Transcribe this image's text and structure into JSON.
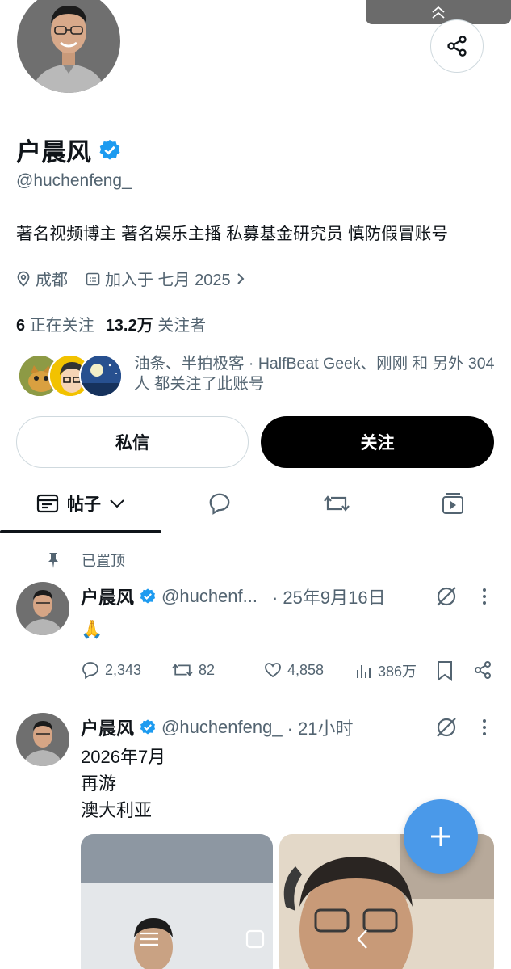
{
  "profile": {
    "name": "户晨风",
    "handle": "@huchenfeng_",
    "bio": "著名视频博主 著名娱乐主播 私募基金研究员 慎防假冒账号",
    "location": "成都",
    "joined": "加入于 七月 2025",
    "following_count": "6",
    "following_label": "正在关注",
    "followers_count": "13.2万",
    "followers_label": "关注者",
    "mutuals_text": "油条、半拍极客 · HalfBeat Geek、刚刚 和 另外 304 人 都关注了此账号"
  },
  "buttons": {
    "dm": "私信",
    "follow": "关注"
  },
  "tabs": {
    "posts": "帖子"
  },
  "pinned_label": "已置顶",
  "posts": [
    {
      "name": "户晨风",
      "handle": "@huchenf...",
      "time": "· 25年9月16日",
      "text": "🙏",
      "replies": "2,343",
      "reposts": "82",
      "likes": "4,858",
      "views": "386万"
    },
    {
      "name": "户晨风",
      "handle": "@huchenfeng_",
      "time": "· 21小时",
      "lines": [
        "2026年7月",
        "再游",
        "澳大利亚"
      ]
    }
  ],
  "colors": {
    "verified": "#1d9bf0",
    "fab": "#4a99e9",
    "text_primary": "#0f1419",
    "text_secondary": "#536471"
  }
}
